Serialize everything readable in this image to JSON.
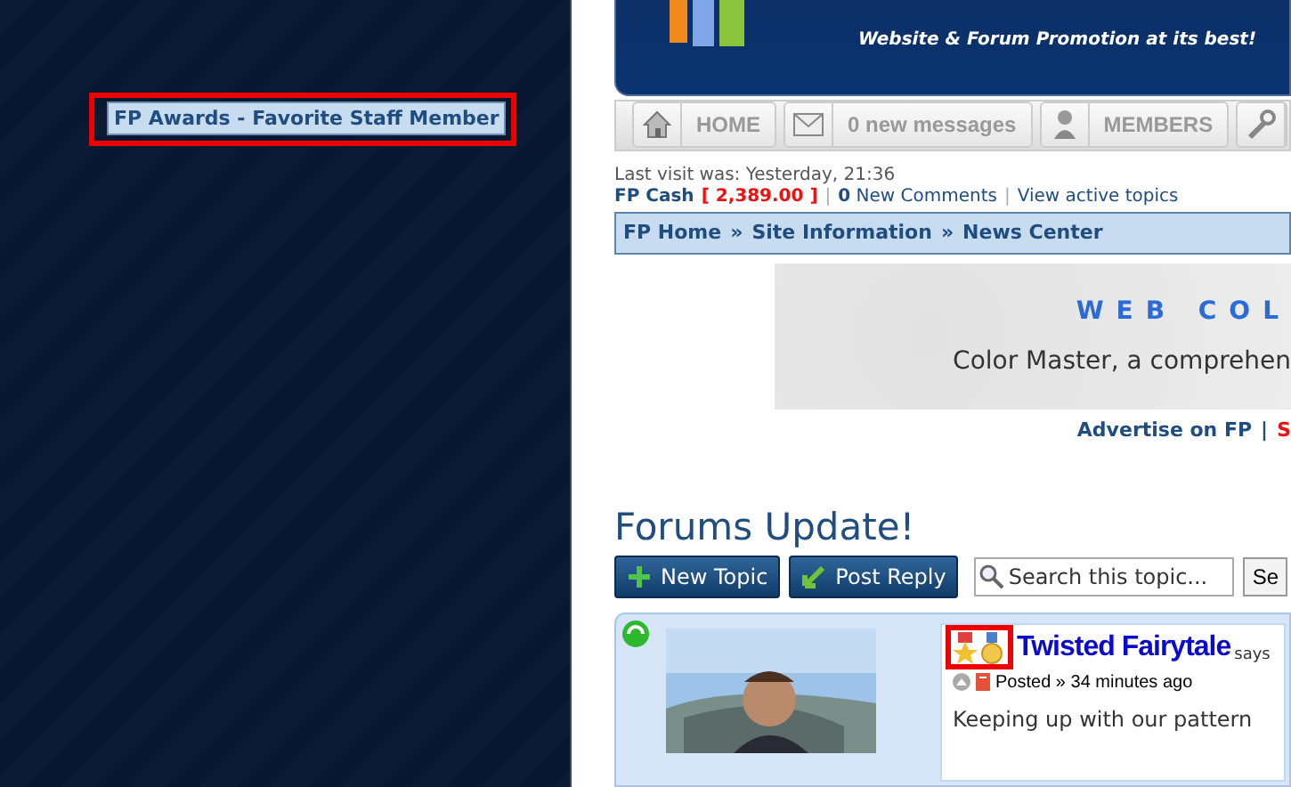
{
  "award_label": "FP Awards - Favorite Staff Member",
  "header": {
    "tagline": "Website & Forum Promotion at its best!"
  },
  "nav": [
    {
      "kind": "home",
      "label": "HOME"
    },
    {
      "kind": "mail",
      "count": "0",
      "label": "new messages"
    },
    {
      "kind": "members",
      "label": "MEMBERS"
    },
    {
      "kind": "tools"
    }
  ],
  "last_visit": "Last visit was: Yesterday, 21:36",
  "cash": {
    "label": "FP Cash",
    "amount": "[ 2,389.00 ]",
    "separators": [
      "|",
      "|"
    ],
    "comments_count": "0",
    "comments_label": "New Comments",
    "active_link": "View active topics"
  },
  "breadcrumb": [
    "FP Home",
    "Site Information",
    "News Center"
  ],
  "breadcrumb_separators": [
    "»",
    "»"
  ],
  "ad": {
    "title": "WEB COL",
    "text": "Color Master, a comprehen"
  },
  "advertise": {
    "link": "Advertise on FP",
    "separator": "|",
    "cut": "S"
  },
  "topic_title": "Forums Update!",
  "buttons": [
    {
      "kind": "new",
      "label": "New Topic"
    },
    {
      "kind": "reply",
      "label": "Post Reply"
    }
  ],
  "search": {
    "placeholder": "Search this topic...",
    "button": "Se"
  },
  "post": {
    "online": true,
    "author": "Twisted Fairytale",
    "says": "says",
    "meta": "Posted » 34 minutes ago",
    "body": "Keeping up with our pattern"
  }
}
